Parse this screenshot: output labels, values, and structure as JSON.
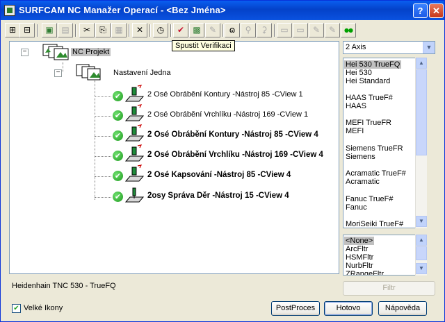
{
  "window": {
    "title": "SURFCAM NC Manažer Operací - <Bez Jména>",
    "help_label": "?",
    "close_label": "✕"
  },
  "toolbar": {
    "tooltip": "Spustit Verifikaci",
    "tools": [
      {
        "name": "expand-all",
        "glyph": "⊞"
      },
      {
        "name": "collapse-all",
        "glyph": "⊟"
      },
      {
        "name": "tool-a",
        "glyph": "▣"
      },
      {
        "name": "tool-b",
        "glyph": "▤"
      },
      {
        "name": "cut",
        "glyph": "✂"
      },
      {
        "name": "copy",
        "glyph": "⎘"
      },
      {
        "name": "paste",
        "glyph": "▦"
      },
      {
        "name": "delete",
        "glyph": "✕"
      },
      {
        "name": "clock",
        "glyph": "◷"
      },
      {
        "name": "verify",
        "glyph": "✔"
      },
      {
        "name": "tool-c",
        "glyph": "▩"
      },
      {
        "name": "tool-d",
        "glyph": "✎"
      },
      {
        "name": "glasses",
        "glyph": "ɷ"
      },
      {
        "name": "tool-e",
        "glyph": "⚲"
      },
      {
        "name": "tool-f",
        "glyph": "⚳"
      },
      {
        "name": "doc",
        "glyph": "▭"
      },
      {
        "name": "edit-doc",
        "glyph": "▭"
      },
      {
        "name": "tool-g",
        "glyph": "✎"
      },
      {
        "name": "tool-h",
        "glyph": "✎"
      },
      {
        "name": "red-dots",
        "glyph": "●●"
      },
      {
        "name": "green-dots",
        "glyph": "●●"
      }
    ]
  },
  "tree": {
    "root": "NC Projekt",
    "setup": "Nastavení Jedna",
    "operations": [
      {
        "label": "2 Osé Obrábění Kontury  -Nástroj 85 -CView 1",
        "bold": false
      },
      {
        "label": "2 Osé Obrábění Vrchlíku  -Nástroj 169 -CView 1",
        "bold": false
      },
      {
        "label": "2 Osé Obrábění Kontury   -Nástroj 85 -CView 4",
        "bold": true
      },
      {
        "label": "2 Osé Obrábění Vrchlíku  -Nástroj 169 -CView 4",
        "bold": true
      },
      {
        "label": "2 Osé Kapsování   -Nástroj 85 -CView 4",
        "bold": true
      },
      {
        "label": "2osy Správa Děr  -Nástroj 15 -CView 4",
        "bold": true
      }
    ]
  },
  "axis_combo": {
    "value": "2 Axis"
  },
  "postprocessors": [
    "Hei 530 TrueFQ",
    "Hei 530",
    "Hei Standard",
    "",
    "HAAS TrueF#",
    "HAAS",
    "",
    "MEFI TrueFR",
    "MEFI",
    "",
    "Siemens TrueFR",
    "Siemens",
    "",
    "Acramatic TrueF#",
    "Acramatic",
    "",
    "Fanuc TrueF#",
    "Fanuc",
    "",
    "MoriSeiki TrueF#"
  ],
  "filters": [
    "<None>",
    "ArcFltr",
    "HSMFltr",
    "NurbFltr",
    "ZRangeFltr"
  ],
  "filter_button": "Filtr",
  "status": "Heidenhain TNC 530 - TrueFQ",
  "large_icons": {
    "label": "Velké Ikony",
    "checked": true
  },
  "buttons": {
    "postproces": "PostProces",
    "ok": "Hotovo",
    "help": "Nápověda"
  }
}
